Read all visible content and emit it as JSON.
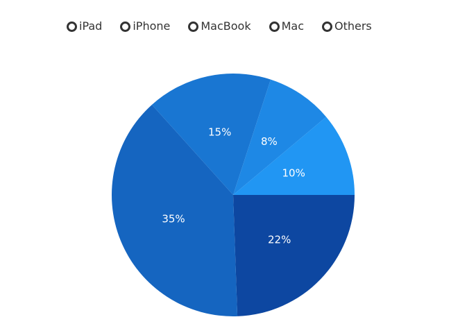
{
  "chart_data": {
    "type": "pie",
    "legend_position": "top",
    "categories": [
      "iPad",
      "iPhone",
      "MacBook",
      "Mac",
      "Others"
    ],
    "values": [
      22,
      35,
      15,
      8,
      10
    ],
    "labels": [
      "22%",
      "35%",
      "15%",
      "8%",
      "10%"
    ],
    "colors": [
      "#0d47a1",
      "#1565c0",
      "#1976d2",
      "#1e88e5",
      "#2196f3"
    ],
    "start_angle_deg": 0,
    "direction": "clockwise"
  }
}
